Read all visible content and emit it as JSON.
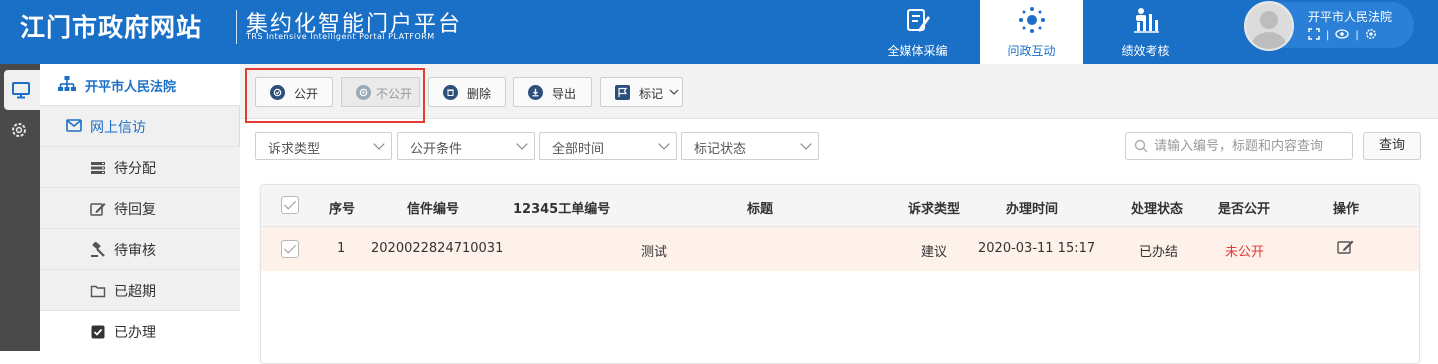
{
  "header": {
    "site_title": "江门市政府网站",
    "platform_title": "集约化智能门户平台",
    "platform_subtitle": "TRS Intensive Intelligent Portal PLATFORM",
    "nav_tabs": [
      {
        "label": "全媒体采编",
        "icon": "edit-document-icon",
        "active": false
      },
      {
        "label": "问政互动",
        "icon": "interaction-network-icon",
        "active": true
      },
      {
        "label": "绩效考核",
        "icon": "performance-chart-icon",
        "active": false
      }
    ],
    "user": {
      "name": "开平市人民法院"
    }
  },
  "rail": {
    "items": [
      {
        "icon": "monitor-icon",
        "active": true
      },
      {
        "icon": "settings-gear-icon",
        "active": false
      }
    ]
  },
  "sidebar": {
    "org_name": "开平市人民法院",
    "group_label": "网上信访",
    "items": [
      {
        "label": "待分配",
        "icon": "list-icon",
        "active": false
      },
      {
        "label": "待回复",
        "icon": "edit-icon",
        "active": false
      },
      {
        "label": "待审核",
        "icon": "gavel-icon",
        "active": false
      },
      {
        "label": "已超期",
        "icon": "folder-icon",
        "active": false
      },
      {
        "label": "已办理",
        "icon": "checked-box-icon",
        "active": true
      }
    ]
  },
  "toolbar": {
    "buttons": [
      {
        "label": "公开",
        "icon": "public-icon",
        "disabled": false
      },
      {
        "label": "不公开",
        "icon": "private-icon",
        "disabled": true
      },
      {
        "label": "删除",
        "icon": "delete-icon",
        "disabled": false
      },
      {
        "label": "导出",
        "icon": "export-icon",
        "disabled": false
      },
      {
        "label": "标记",
        "icon": "flag-icon",
        "disabled": false
      }
    ]
  },
  "filters": {
    "selects": [
      "诉求类型",
      "公开条件",
      "全部时间",
      "标记状态"
    ],
    "search_placeholder": "请输入编号，标题和内容查询",
    "query_label": "查询"
  },
  "table": {
    "columns": [
      "序号",
      "信件编号",
      "12345工单编号",
      "标题",
      "诉求类型",
      "办理时间",
      "处理状态",
      "是否公开",
      "操作"
    ],
    "rows": [
      {
        "index": "1",
        "letter_no": "2020022824710031",
        "ticket_no": "",
        "title": "测试",
        "type": "建议",
        "time": "2020-03-11 15:17",
        "status": "已办结",
        "public": "未公开"
      }
    ]
  },
  "colors": {
    "brand": "#1a6fc7",
    "highlight": "#e53935",
    "unpublished": "#e53935"
  }
}
